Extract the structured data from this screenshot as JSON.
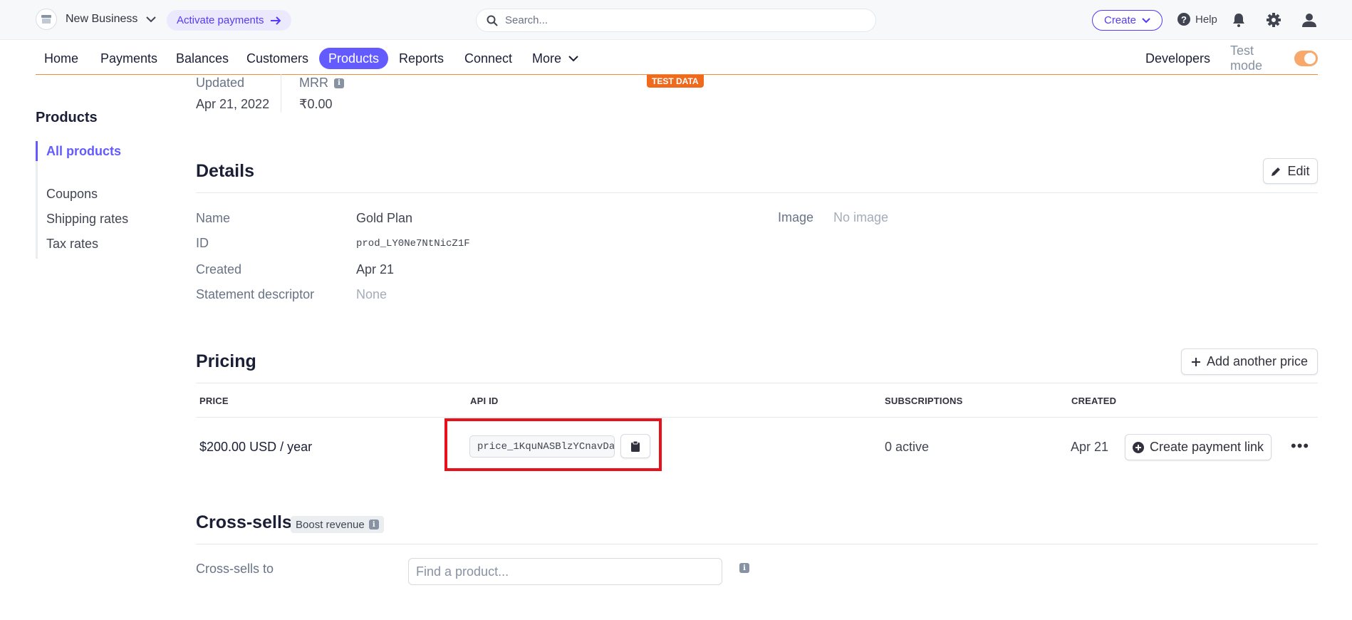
{
  "topbar": {
    "account_name": "New Business",
    "activate_label": "Activate payments",
    "search_placeholder": "Search...",
    "create_label": "Create",
    "help_label": "Help"
  },
  "nav": {
    "items": [
      "Home",
      "Payments",
      "Balances",
      "Customers",
      "Products",
      "Reports",
      "Connect",
      "More"
    ],
    "active": "Products",
    "developers": "Developers",
    "test_mode": "Test mode",
    "test_mode_on": true
  },
  "test_data_badge": "TEST DATA",
  "summary": {
    "updated_label": "Updated",
    "updated_value": "Apr 21, 2022",
    "mrr_label": "MRR",
    "mrr_value": "₹0.00"
  },
  "sidebar": {
    "title": "Products",
    "items": [
      "All products",
      "Coupons",
      "Shipping rates",
      "Tax rates"
    ],
    "active": "All products"
  },
  "details": {
    "heading": "Details",
    "edit_label": "Edit",
    "name_label": "Name",
    "name_value": "Gold Plan",
    "id_label": "ID",
    "id_value": "prod_LY0Ne7NtNicZ1F",
    "created_label": "Created",
    "created_value": "Apr 21",
    "descriptor_label": "Statement descriptor",
    "descriptor_value": "None",
    "image_label": "Image",
    "image_value": "No image"
  },
  "pricing": {
    "heading": "Pricing",
    "add_price_label": "Add another price",
    "columns": [
      "PRICE",
      "API ID",
      "SUBSCRIPTIONS",
      "CREATED"
    ],
    "row": {
      "price": "$200.00 USD / year",
      "api_id": "price_1KquNASBlzYCnavDa",
      "subscriptions": "0 active",
      "created": "Apr 21",
      "payment_link_label": "Create payment link"
    }
  },
  "cross_sells": {
    "heading": "Cross-sells",
    "badge": "Boost revenue",
    "label": "Cross-sells to",
    "input_placeholder": "Find a product..."
  },
  "colors": {
    "accent": "#635bff",
    "highlight": "#e8101a",
    "test_orange": "#f06a1d"
  }
}
